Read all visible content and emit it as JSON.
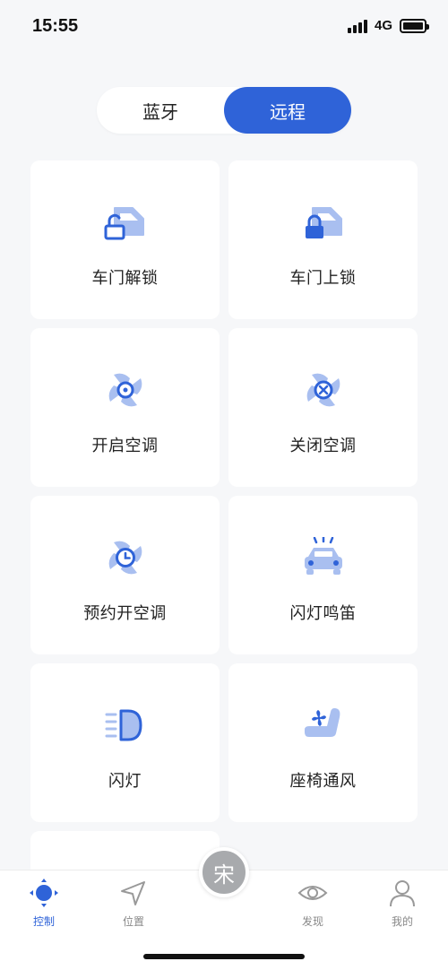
{
  "status_bar": {
    "time": "15:55",
    "network": "4G"
  },
  "mode_switch": {
    "bluetooth": "蓝牙",
    "remote": "远程",
    "selected": "remote"
  },
  "controls": [
    {
      "label": "车门解锁",
      "icon": "door-unlock-icon"
    },
    {
      "label": "车门上锁",
      "icon": "door-lock-icon"
    },
    {
      "label": "开启空调",
      "icon": "ac-on-icon"
    },
    {
      "label": "关闭空调",
      "icon": "ac-off-icon"
    },
    {
      "label": "预约开空调",
      "icon": "ac-schedule-icon"
    },
    {
      "label": "闪灯鸣笛",
      "icon": "car-flash-horn-icon"
    },
    {
      "label": "闪灯",
      "icon": "headlight-icon"
    },
    {
      "label": "座椅通风",
      "icon": "seat-ventilation-icon"
    }
  ],
  "tabs": [
    {
      "label": "控制",
      "icon": "control-dpad-icon",
      "active": true
    },
    {
      "label": "位置",
      "icon": "location-arrow-icon",
      "active": false
    },
    {
      "label": "宋",
      "icon": "brand-emblem-icon",
      "active": false
    },
    {
      "label": "发现",
      "icon": "eye-icon",
      "active": false
    },
    {
      "label": "我的",
      "icon": "profile-icon",
      "active": false
    }
  ],
  "colors": {
    "accent": "#2f63d8",
    "accent_light": "#a9bff0",
    "background": "#f6f7f9"
  }
}
